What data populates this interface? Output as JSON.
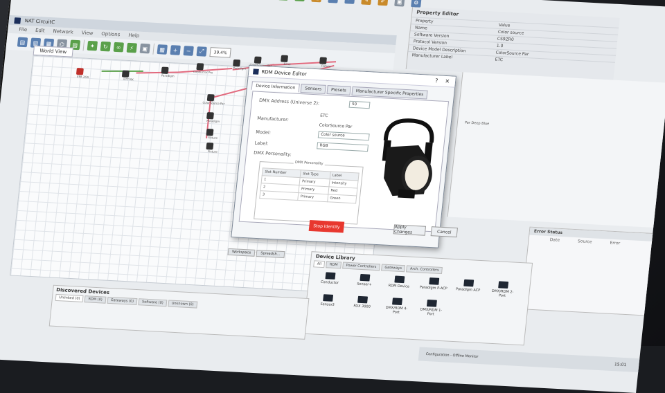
{
  "app": {
    "title": "NAT CircuitC",
    "menu": [
      "File",
      "Edit",
      "Network",
      "View",
      "Options",
      "Help"
    ],
    "zoom": "39.4%"
  },
  "canvas": {
    "tab_label": "World View",
    "nodes": [
      {
        "label": "EPA 2GS"
      },
      {
        "label": "ETC NX"
      },
      {
        "label": "Paradigm"
      },
      {
        "label": "Conductor Pro"
      },
      {
        "label": "Paradigm"
      },
      {
        "label": "ColorSource Par"
      },
      {
        "label": "Emer"
      },
      {
        "label": "Fixture"
      },
      {
        "label": "ColorSource Par"
      },
      {
        "label": "Paradigm"
      },
      {
        "label": "Fixture"
      },
      {
        "label": "Fixture"
      }
    ]
  },
  "workspace_tabs": [
    "Workspace",
    "Spreadsh..."
  ],
  "property_editor": {
    "title": "Property Editor",
    "columns": [
      "Property",
      "Value"
    ],
    "rows": [
      {
        "name": "Name",
        "value": "Color source"
      },
      {
        "name": "Software Version",
        "value": "CS9ZR0"
      },
      {
        "name": "Protocol Version",
        "value": "1.0"
      },
      {
        "name": "Device Model Description",
        "value": "ColorSource Par"
      },
      {
        "name": "Manufacturer Label",
        "value": "ETC"
      }
    ]
  },
  "right_fragments": [
    "Par Deep Blue"
  ],
  "dialog": {
    "title": "RDM Device Editor",
    "controls": [
      "?",
      "✕"
    ],
    "tabs": [
      "Device Information",
      "Sensors",
      "Presets",
      "Manufacturer Specific Properties"
    ],
    "dmx_address_label": "DMX Address (Universe 2):",
    "dmx_address_value": "50",
    "manufacturer_label": "Manufacturer:",
    "manufacturer_value": "ETC",
    "model_label": "Model:",
    "model_value": "ColorSource Par",
    "label_label": "Label:",
    "label_value": "Color source",
    "personality_label": "DMX Personality:",
    "personality_value": "RGB",
    "personality_group": "DMX Personality",
    "slot_columns": [
      "Slot Number",
      "Slot Type",
      "Label"
    ],
    "slots": [
      {
        "num": "1",
        "type": "Primary",
        "label": "Intensity"
      },
      {
        "num": "2",
        "type": "Primary",
        "label": "Red"
      },
      {
        "num": "3",
        "type": "Primary",
        "label": "Green"
      }
    ],
    "stop_identify": "Stop Identify",
    "apply": "Apply Changes",
    "cancel": "Cancel"
  },
  "error_panel": {
    "title": "Error Status",
    "columns": [
      "Date",
      "Source",
      "Error"
    ]
  },
  "device_library": {
    "title": "Device Library",
    "tabs": [
      "All",
      "RDM",
      "Power Controllers",
      "Gateways",
      "Arch. Controllers"
    ],
    "items": [
      "Conductor",
      "Sensor+",
      "RDM Device",
      "Paradigm P-ACP",
      "Paradigm ACP",
      "DMX/RDM 2-Port",
      "Sensor3",
      "FDX 3000",
      "DMX/RDM 4-Port",
      "DMX/RDM 1-Port"
    ]
  },
  "discovered_devices": {
    "title": "Discovered Devices",
    "tabs": [
      "Unlinked (0)",
      "RDM (0)",
      "Gateways (0)",
      "Software (0)",
      "Unknown (0)"
    ]
  },
  "taskbar": {
    "status": "Configuration - Offline Monitor",
    "time": "15:01"
  },
  "colors": {
    "accent": "#5a7fb0",
    "edge": "#e26a7e",
    "stop": "#e8382f"
  }
}
